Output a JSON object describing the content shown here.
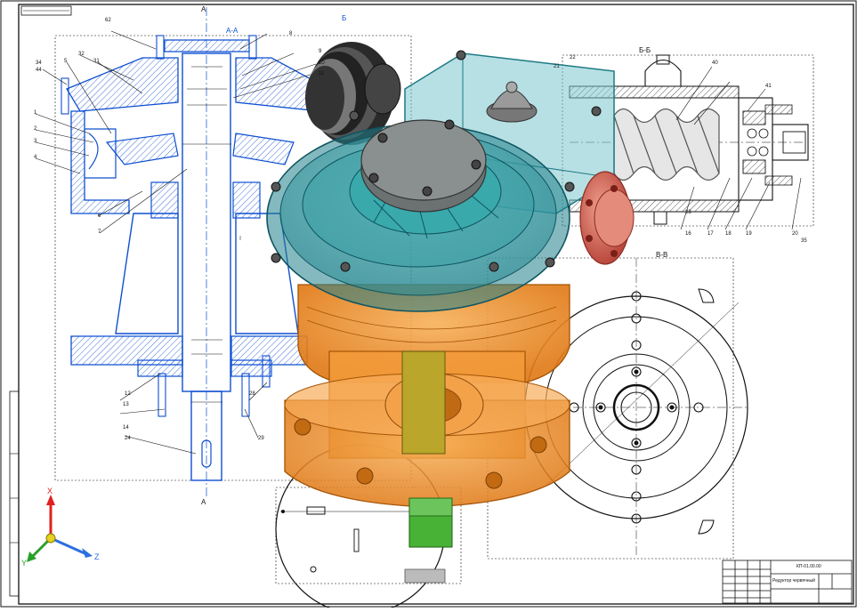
{
  "drawing": {
    "stamp": "",
    "section_labels": {
      "aa": "А-А",
      "bb": "Б-Б",
      "vv": "В-В",
      "cut_a": "А",
      "cut_b": "Б"
    },
    "callouts_left": [
      "62",
      "34",
      "44",
      "32",
      "31",
      "1",
      "2",
      "3",
      "4",
      "5",
      "6",
      "7",
      "8",
      "9",
      "10",
      "11",
      "12",
      "13",
      "14",
      "24",
      "28",
      "29"
    ],
    "callouts_right": [
      "40",
      "41",
      "16",
      "17",
      "18",
      "19",
      "20",
      "21",
      "22",
      "23",
      "35"
    ],
    "colors": {
      "blue_lines": "#0f4fd1",
      "black_lines": "#111111",
      "housing_orange": "#f08a24",
      "lid_teal": "#37a6ad",
      "flange_red": "#d4675a",
      "shaft_green": "#3aa52f",
      "shaft_yellow": "#b8a227"
    }
  },
  "triad": {
    "x": "X",
    "y": "Y",
    "z": "Z"
  },
  "title_block": {
    "doc_no": "КП-01.00.00",
    "name": "Редуктор червячный"
  }
}
